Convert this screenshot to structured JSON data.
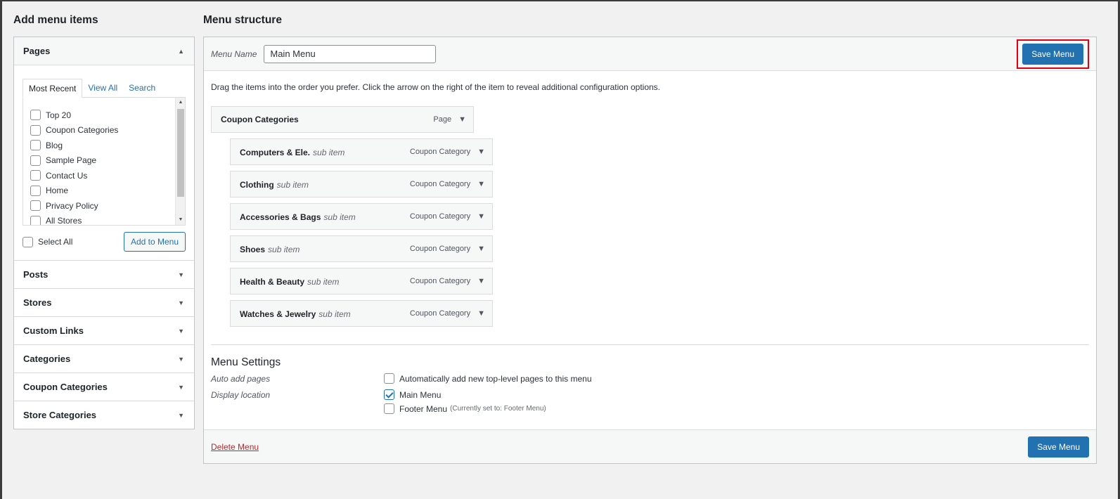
{
  "left": {
    "title": "Add menu items",
    "pages_section": {
      "title": "Pages",
      "tabs": [
        "Most Recent",
        "View All",
        "Search"
      ],
      "items": [
        "Top 20",
        "Coupon Categories",
        "Blog",
        "Sample Page",
        "Contact Us",
        "Home",
        "Privacy Policy",
        "All Stores"
      ],
      "select_all_label": "Select All",
      "add_button": "Add to Menu"
    },
    "sections": [
      "Posts",
      "Stores",
      "Custom Links",
      "Categories",
      "Coupon Categories",
      "Store Categories"
    ]
  },
  "right": {
    "title": "Menu structure",
    "menu_name_label": "Menu Name",
    "menu_name_value": "Main Menu",
    "save_button": "Save Menu",
    "instructions": "Drag the items into the order you prefer. Click the arrow on the right of the item to reveal additional configuration options.",
    "items": [
      {
        "title": "Coupon Categories",
        "sub": "",
        "type": "Page"
      },
      {
        "title": "Computers & Ele.",
        "sub": "sub item",
        "type": "Coupon Category"
      },
      {
        "title": "Clothing",
        "sub": "sub item",
        "type": "Coupon Category"
      },
      {
        "title": "Accessories & Bags",
        "sub": "sub item",
        "type": "Coupon Category"
      },
      {
        "title": "Shoes",
        "sub": "sub item",
        "type": "Coupon Category"
      },
      {
        "title": "Health & Beauty",
        "sub": "sub item",
        "type": "Coupon Category"
      },
      {
        "title": "Watches & Jewelry",
        "sub": "sub item",
        "type": "Coupon Category"
      }
    ],
    "settings": {
      "title": "Menu Settings",
      "auto_add_label": "Auto add pages",
      "auto_add_option": "Automatically add new top-level pages to this menu",
      "display_location_label": "Display location",
      "location_main": "Main Menu",
      "location_footer": "Footer Menu",
      "location_footer_note": "(Currently set to: Footer Menu)"
    },
    "delete_link": "Delete Menu"
  },
  "colors": {
    "primary": "#2271b1",
    "highlight": "#e1000f",
    "delete": "#b32d2e"
  }
}
